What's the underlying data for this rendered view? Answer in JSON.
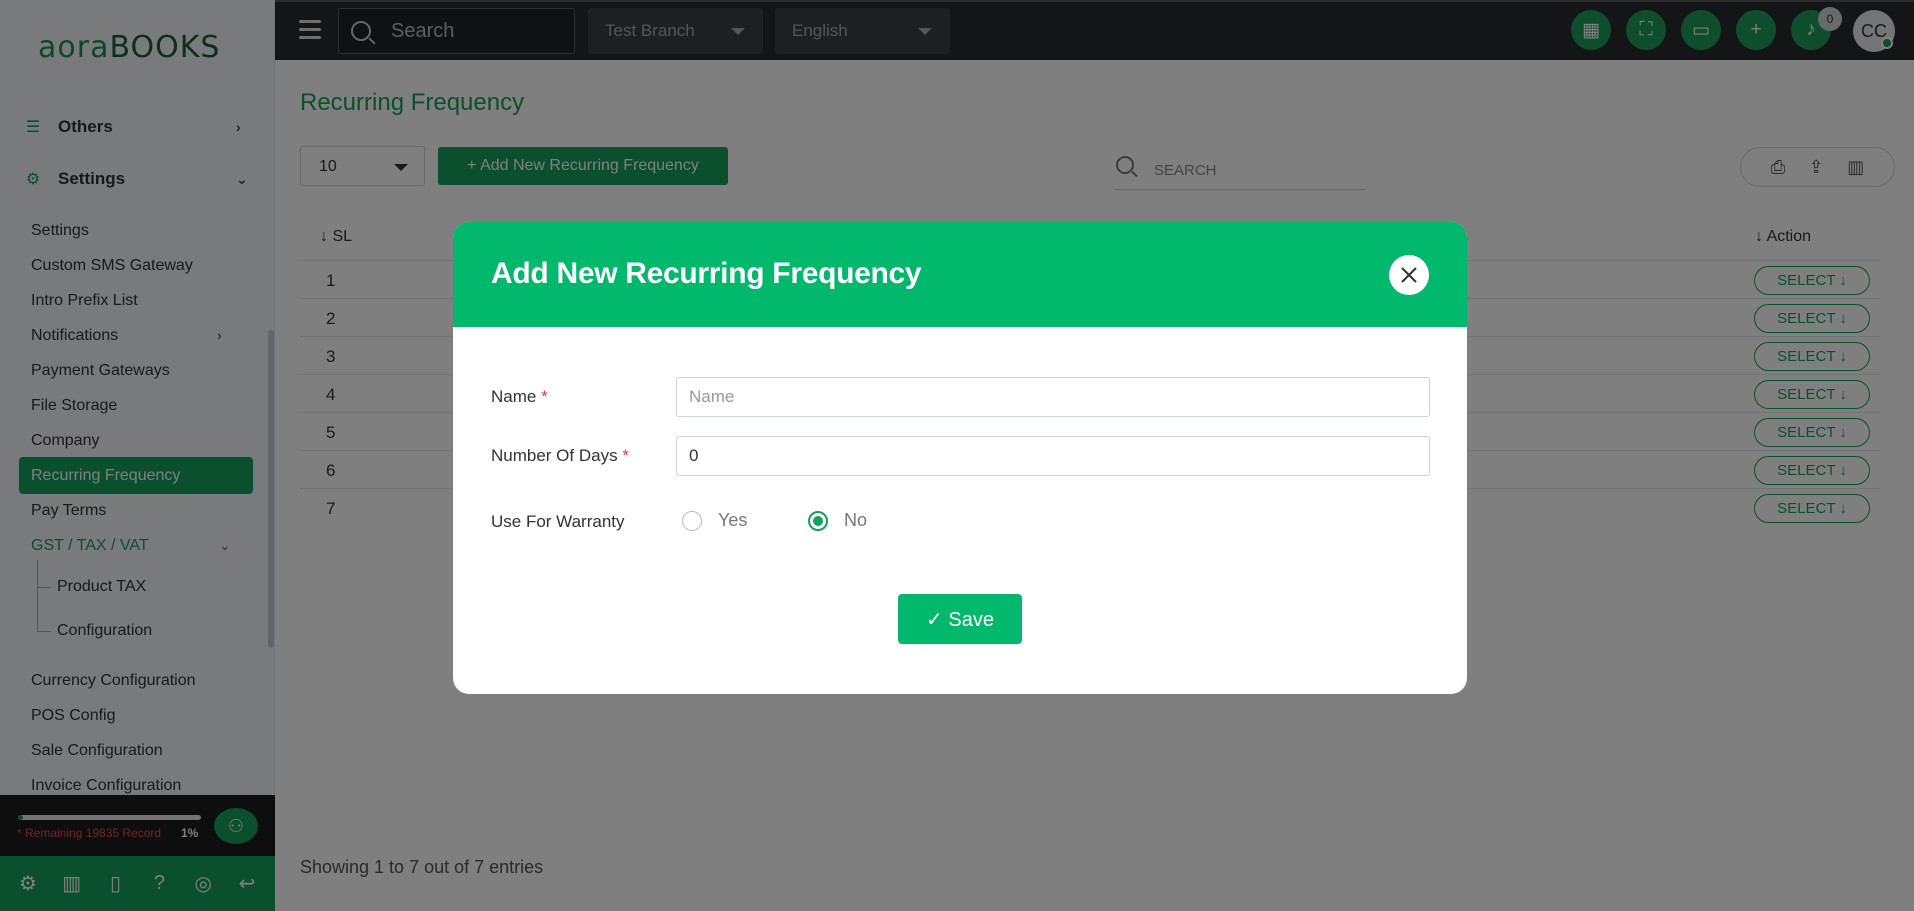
{
  "logo": {
    "part1": "aora",
    "part2": "BOOKS"
  },
  "sidebar": {
    "groups": [
      {
        "label": "Others",
        "icon": "list-icon"
      },
      {
        "label": "Settings",
        "icon": "gear-icon"
      }
    ],
    "items": [
      "Settings",
      "Custom SMS Gateway",
      "Intro Prefix List",
      "Notifications",
      "Payment Gateways",
      "File Storage",
      "Company",
      "Recurring Frequency",
      "Pay Terms",
      "GST / TAX / VAT",
      "Currency Configuration",
      "POS Config",
      "Sale Configuration",
      "Invoice Configuration"
    ],
    "subitems": [
      "Product TAX",
      "Configuration"
    ],
    "quota": {
      "text": "* Remaining 19835 Record",
      "percent": "1%",
      "progress": 0.01
    }
  },
  "topbar": {
    "search_placeholder": "Search",
    "branch": "Test Branch",
    "language": "English",
    "notification_count": "0",
    "avatar": "CC"
  },
  "main": {
    "title": "Recurring Frequency",
    "per_page": "10",
    "add_button": "+ Add New Recurring Frequency",
    "search_placeholder": "SEARCH",
    "columns": {
      "sl": "↓ SL",
      "action": "↓ Action"
    },
    "rows": [
      "1",
      "2",
      "3",
      "4",
      "5",
      "6",
      "7"
    ],
    "select_label": "SELECT ↓",
    "footer": "Showing 1 to 7 out of 7 entries"
  },
  "modal": {
    "title": "Add New Recurring Frequency",
    "name_label": "Name",
    "name_placeholder": "Name",
    "days_label": "Number Of Days",
    "days_value": "0",
    "warranty_label": "Use For Warranty",
    "yes": "Yes",
    "no": "No",
    "required_mark": "*",
    "save": "✓ Save"
  }
}
